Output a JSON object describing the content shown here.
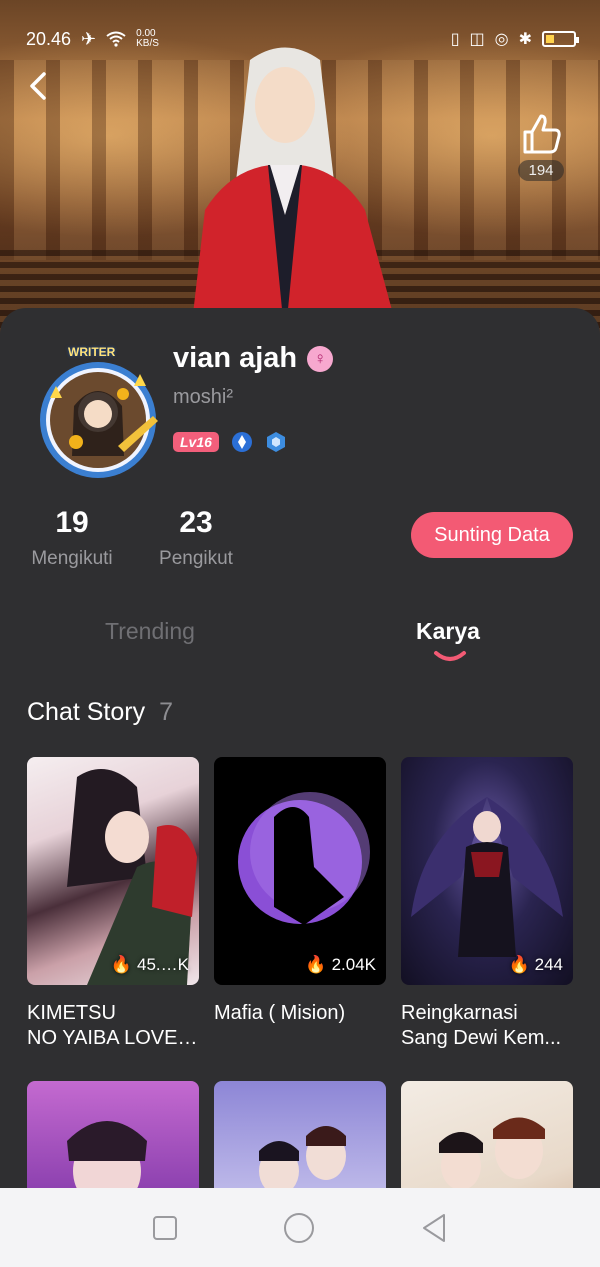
{
  "status_bar": {
    "time": "20.46",
    "speed_value": "0.00",
    "speed_unit": "KB/S"
  },
  "header": {
    "like_count": "194"
  },
  "profile": {
    "name": "vian ajah",
    "gender_symbol": "♀",
    "handle": "moshi²",
    "avatar_banner": "WRITER",
    "level": "Lv16"
  },
  "stats": {
    "following": {
      "value": "19",
      "label": "Mengikuti"
    },
    "followers": {
      "value": "23",
      "label": "Pengikut"
    }
  },
  "edit_button": "Sunting Data",
  "tabs": [
    {
      "label": "Trending",
      "active": false
    },
    {
      "label": "Karya",
      "active": true
    }
  ],
  "section": {
    "title": "Chat Story",
    "count": "7"
  },
  "stories": [
    {
      "views": "45.…K",
      "title_line1": "KIMETSU",
      "title_line2": "NO YAIBA LOVE ..."
    },
    {
      "views": "2.04K",
      "title_line1": "Mafia ( Mision)",
      "title_line2": ""
    },
    {
      "views": "244",
      "title_line1": "Reingkarnasi",
      "title_line2": "Sang Dewi Kem..."
    }
  ],
  "colors": {
    "accent": "#f35a74",
    "background": "#2f2f31",
    "muted": "#9a9a9e"
  }
}
